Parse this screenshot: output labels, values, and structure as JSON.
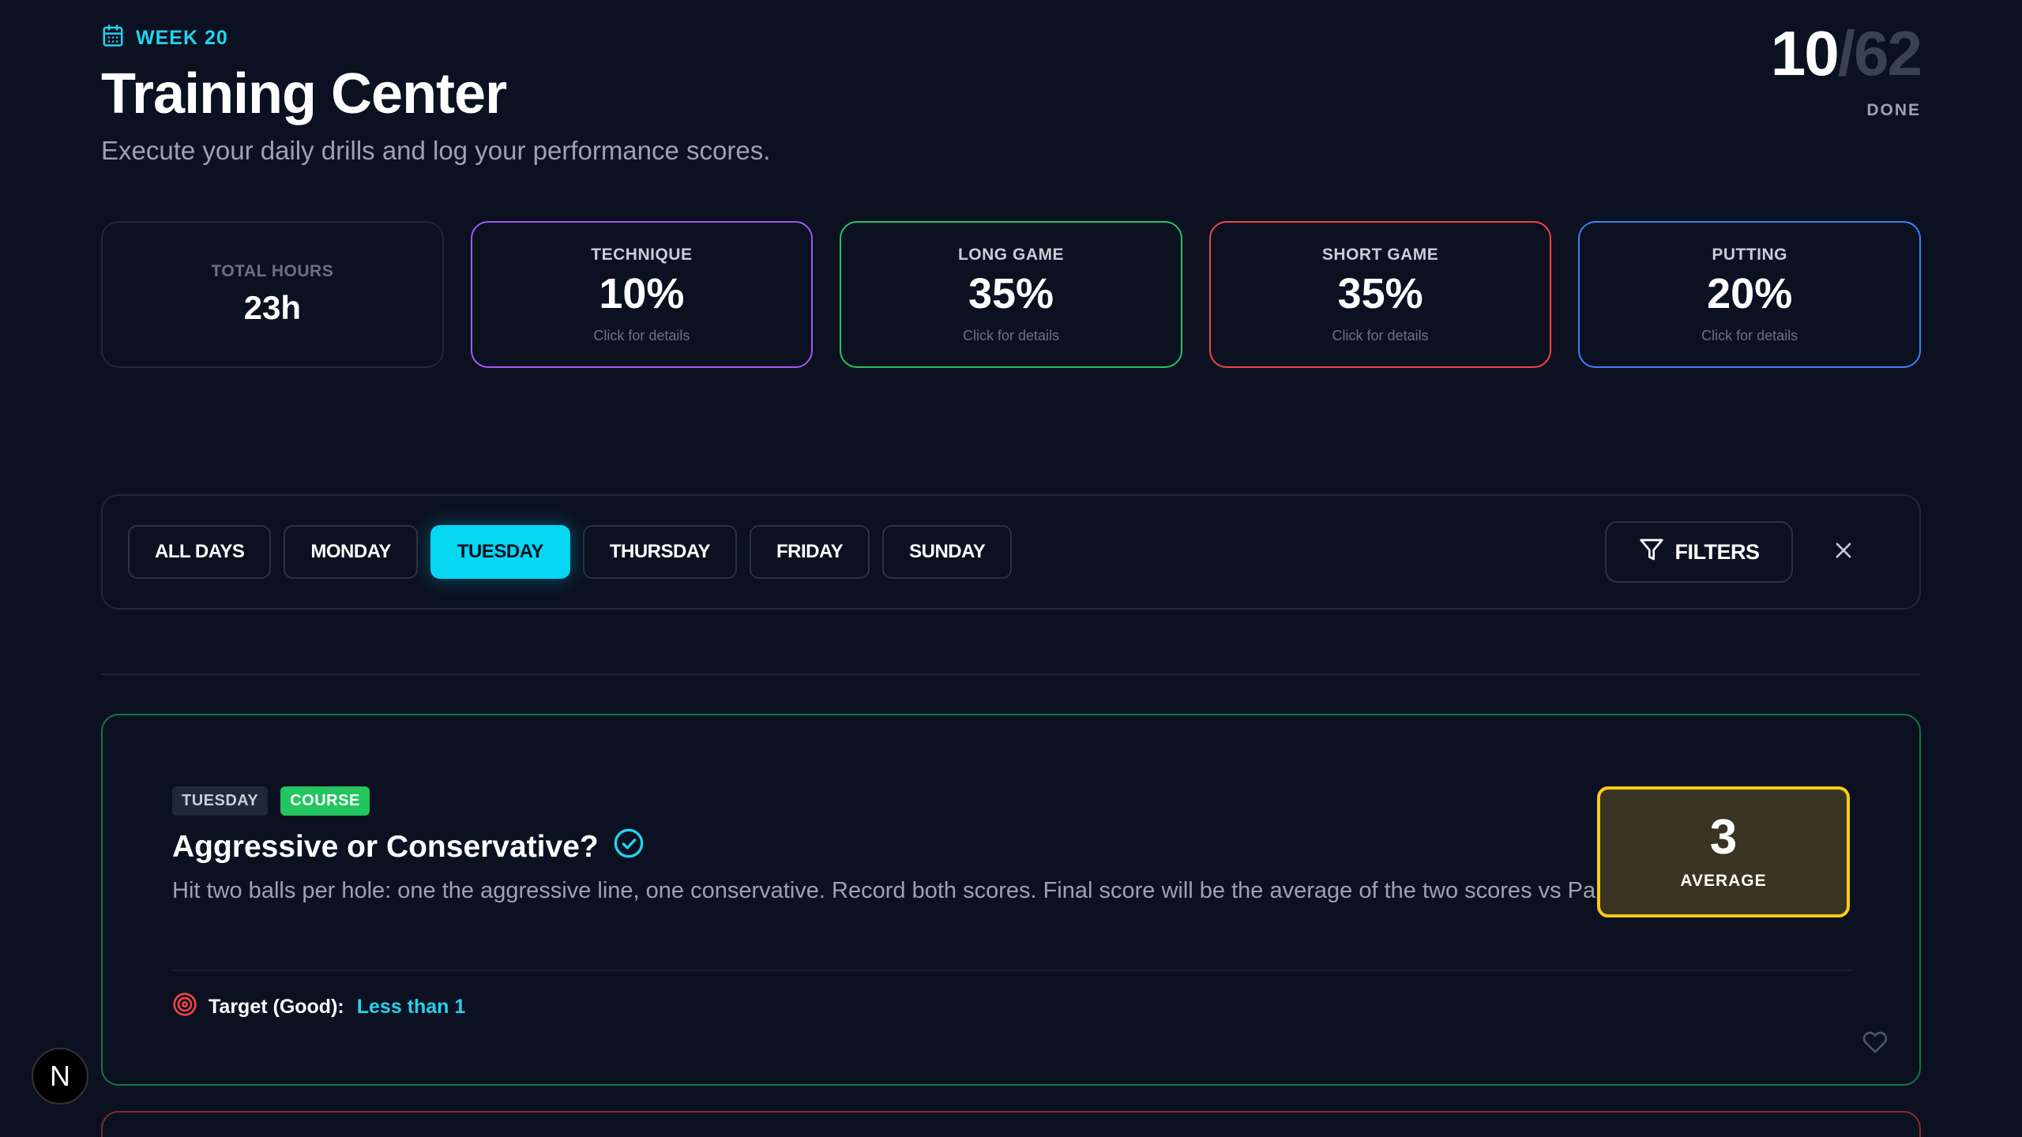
{
  "header": {
    "week_label": "WEEK 20",
    "title": "Training Center",
    "subtitle": "Execute your daily drills and log your performance scores."
  },
  "progress": {
    "done": "10",
    "separator": "/",
    "total": "62",
    "label": "DONE"
  },
  "stats": [
    {
      "label": "TOTAL HOURS",
      "value": "23h"
    },
    {
      "label": "TECHNIQUE",
      "value": "10%",
      "hint": "Click for details",
      "color": "#a855f7"
    },
    {
      "label": "LONG GAME",
      "value": "35%",
      "hint": "Click for details",
      "color": "#22c55e"
    },
    {
      "label": "SHORT GAME",
      "value": "35%",
      "hint": "Click for details",
      "color": "#ef4444"
    },
    {
      "label": "PUTTING",
      "value": "20%",
      "hint": "Click for details",
      "color": "#3b82f6"
    }
  ],
  "filters": {
    "days": [
      "ALL DAYS",
      "MONDAY",
      "TUESDAY",
      "THURSDAY",
      "FRIDAY",
      "SUNDAY"
    ],
    "active_day": "TUESDAY",
    "filters_label": "FILTERS"
  },
  "drill": {
    "day_tag": "TUESDAY",
    "category_tag": "COURSE",
    "title": "Aggressive or Conservative?",
    "description": "Hit two balls per hole: one the aggressive line, one conservative. Record both scores. Final score will be the average of the two scores vs Par.",
    "target_label": "Target (Good):",
    "target_value": "Less than 1",
    "score_value": "3",
    "score_label": "AVERAGE"
  },
  "badge": {
    "letter": "N"
  },
  "colors": {
    "accent": "#22d3ee",
    "active_tab": "#06d6f2",
    "score_border": "#facc15",
    "background": "#0b1121"
  }
}
